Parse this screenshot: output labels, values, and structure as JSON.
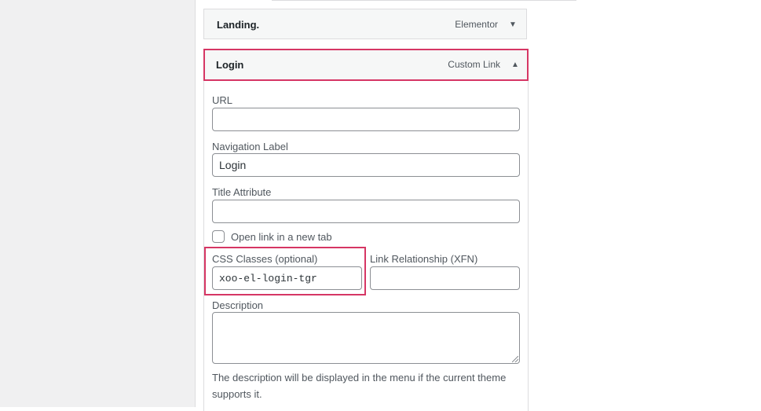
{
  "menu_items": [
    {
      "title": "Landing.",
      "type": "Elementor",
      "toggle_icon": "▼"
    },
    {
      "title": "Login",
      "type": "Custom Link",
      "toggle_icon": "▲"
    }
  ],
  "settings": {
    "url": {
      "label": "URL",
      "value": ""
    },
    "navigation_label": {
      "label": "Navigation Label",
      "value": "Login"
    },
    "title_attribute": {
      "label": "Title Attribute",
      "value": ""
    },
    "open_new_tab": {
      "label": "Open link in a new tab",
      "checked": false
    },
    "css_classes": {
      "label": "CSS Classes (optional)",
      "value": "xoo-el-login-tgr"
    },
    "link_relationship": {
      "label": "Link Relationship (XFN)",
      "value": ""
    },
    "description": {
      "label": "Description",
      "value": "",
      "help_line1": "The description will be displayed in the menu if the current theme",
      "help_line2": "supports it."
    }
  },
  "colors": {
    "highlight": "#d63664",
    "border": "#dcdcde",
    "input_border": "#8c8f94"
  }
}
